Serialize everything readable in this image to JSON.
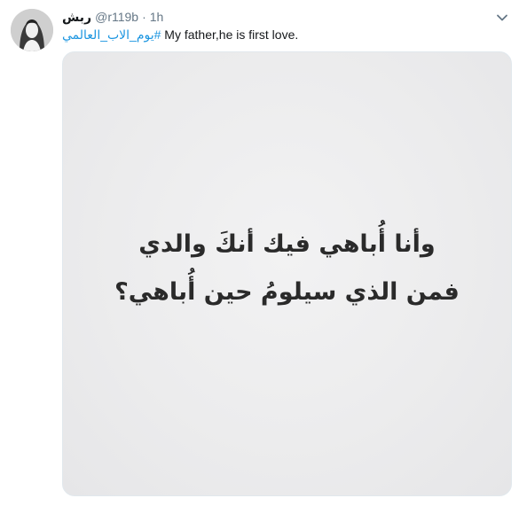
{
  "tweet": {
    "display_name": "ربش",
    "handle": "@r119b",
    "separator": "·",
    "time": "1h",
    "hashtag": "#يوم_الاب_العالمي",
    "body_text": " My father,he is first love.",
    "menu_icon": "chevron-down-icon",
    "avatar_icon": "profile-avatar",
    "image_text": {
      "line1": "وأنا أُباهي فيك أنكَ والدي",
      "line2": "فمن الذي سيلومُ حين أُباهي؟"
    }
  },
  "colors": {
    "link": "#1b95e0",
    "meta_text": "#657786",
    "primary_text": "#14171a",
    "image_background": "#ececed"
  }
}
